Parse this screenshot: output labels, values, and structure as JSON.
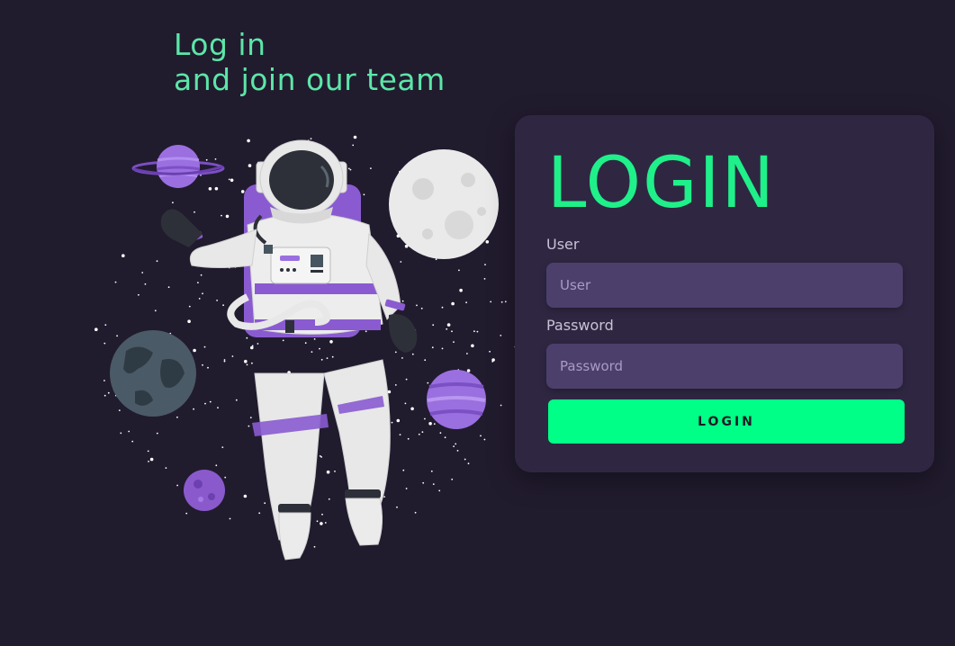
{
  "hero": {
    "line1": "Log in",
    "line2": "and join our team"
  },
  "login": {
    "heading": "LOGIN",
    "user_label": "User",
    "user_placeholder": "User",
    "password_label": "Password",
    "password_placeholder": "Password",
    "button_label": "LOGIN"
  },
  "colors": {
    "background": "#211b2e",
    "card": "#2f2742",
    "accent": "#00ff87",
    "input": "#4d3f6c",
    "purple": "#8f5fd6"
  },
  "illustration": {
    "icons": [
      "astronaut-icon",
      "ringed-planet-icon",
      "moon-icon",
      "earth-icon",
      "purple-planet-icon",
      "small-planet-icon",
      "stars-icon"
    ]
  }
}
